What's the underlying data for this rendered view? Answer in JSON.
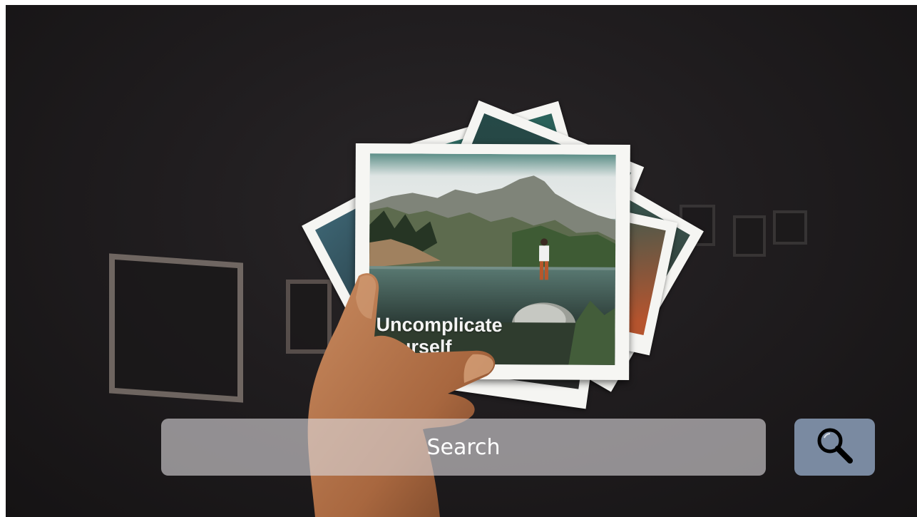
{
  "background": {
    "photo_caption_line1": "Uncomplicate",
    "photo_caption_line2": "Yourself"
  },
  "search": {
    "placeholder": "Search",
    "button_icon": "search-icon"
  },
  "colors": {
    "search_bar_bg": "#dcd8dc",
    "search_button_bg": "#7a8aa1",
    "text": "#ffffff"
  }
}
